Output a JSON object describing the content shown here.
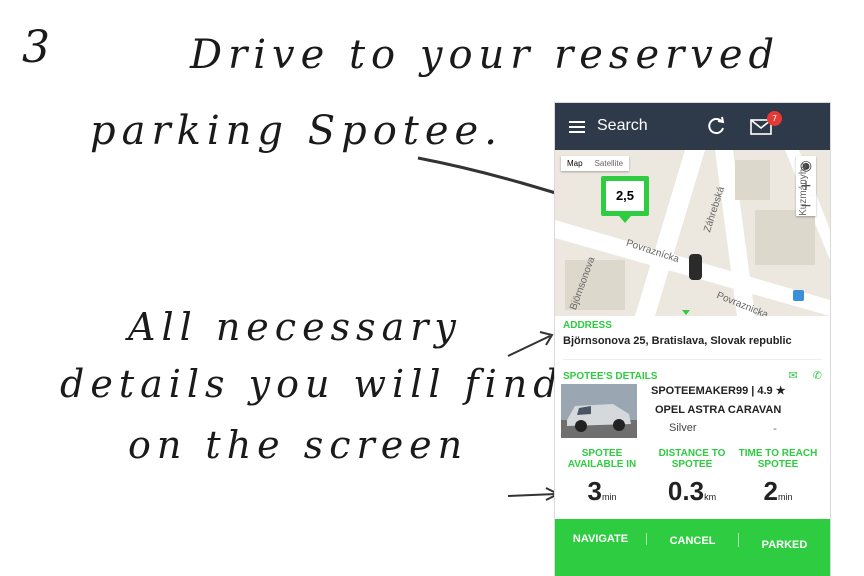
{
  "annotations": {
    "step_number": "3",
    "title_line1": "Drive to your reserved",
    "title_line2": "parking Spotee.",
    "caption_line1": "All necessary",
    "caption_line2": "details you will find",
    "caption_line3": "on the screen"
  },
  "app": {
    "header": {
      "title": "Search",
      "notification_count": "7",
      "icons": [
        "menu-icon",
        "refresh-icon",
        "mail-icon"
      ]
    },
    "map": {
      "tabs": [
        "Map",
        "Satellite"
      ],
      "selected_tab": "Map",
      "zoom_in": "+",
      "zoom_out": "−",
      "price_marker": "2,5",
      "streets": [
        "Povraznícka",
        "Záhrebská",
        "Björnsonova",
        "Povraznicka",
        "Kuzmányho"
      ]
    },
    "address": {
      "label": "ADDRESS",
      "value": "Björnsonova 25, Bratislava, Slovak republic"
    },
    "details": {
      "label": "SPOTEE'S DETAILS",
      "owner": "SPOTEEMAKER99 | 4.9 ★",
      "car_model": "OPEL ASTRA CARAVAN",
      "car_color": "Silver",
      "extra": "-"
    },
    "stats": [
      {
        "label": "SPOTEE AVAILABLE IN",
        "value": "3",
        "unit": "min"
      },
      {
        "label": "DISTANCE TO SPOTEE",
        "value": "0.3",
        "unit": "km"
      },
      {
        "label": "TIME TO REACH SPOTEE",
        "value": "2",
        "unit": "min"
      }
    ],
    "actions": {
      "navigate": "NAVIGATE",
      "cancel": "CANCEL",
      "parked": "PARKED"
    }
  },
  "colors": {
    "accent": "#2ecc40",
    "header": "#2e3a4a",
    "badge": "#e53935"
  }
}
